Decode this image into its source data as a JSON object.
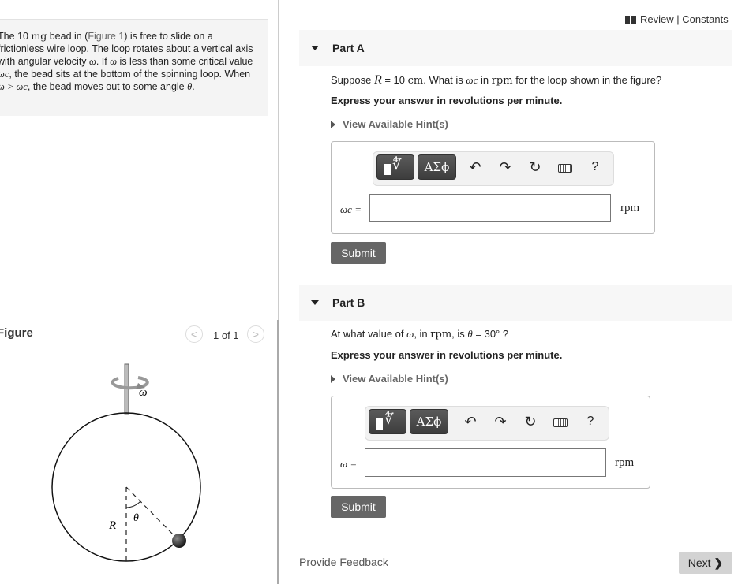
{
  "problem": {
    "intro_parts": [
      "The 10 ",
      "mg",
      " bead in (",
      "Figure 1",
      ") is free to slide on a frictionless wire loop. The loop rotates about a vertical axis with angular velocity ",
      "ω",
      ". If ",
      "ω",
      " is less than some critical value ",
      "ωc",
      ", the bead sits at the bottom of the spinning loop. When ",
      "ω > ωc",
      ", the bead moves out to some angle ",
      "θ",
      "."
    ],
    "figure_link": "Figure 1"
  },
  "figure": {
    "title": "Figure",
    "pager_label": "1 of 1",
    "prev_icon": "chevron-left-icon",
    "next_icon": "chevron-right-icon",
    "labels": {
      "omega": "ω",
      "radius": "R",
      "angle": "θ"
    }
  },
  "header": {
    "review_icon": "book-icon",
    "review_label": "Review | Constants"
  },
  "toolbar": {
    "template_icon": "template-root-icon",
    "greek_label": "ΑΣϕ",
    "undo_icon": "undo-icon",
    "redo_icon": "redo-icon",
    "reset_icon": "reset-icon",
    "keyboard_icon": "keyboard-icon",
    "help_label": "?"
  },
  "parts": [
    {
      "title": "Part A",
      "question_prefix": "Suppose ",
      "question_R": "R",
      "question_mid1": " = 10 ",
      "question_unit": "cm",
      "question_mid2": ". What is ",
      "question_var": "ωc",
      "question_mid3": " in ",
      "question_rpm": "rpm",
      "question_suffix": " for the loop shown in the figure?",
      "instruction": "Express your answer in revolutions per minute.",
      "hint_label": "View Available Hint(s)",
      "var_label": "ωc =",
      "input_value": "",
      "unit": "rpm",
      "submit_label": "Submit"
    },
    {
      "title": "Part B",
      "question_prefix": "At what value of ",
      "question_var": "ω",
      "question_mid1": ", in ",
      "question_rpm": "rpm",
      "question_mid2": ", is ",
      "question_theta": "θ",
      "question_suffix": " = 30° ?",
      "instruction": "Express your answer in revolutions per minute.",
      "hint_label": "View Available Hint(s)",
      "var_label": "ω =",
      "input_value": "",
      "unit": "rpm",
      "submit_label": "Submit"
    }
  ],
  "footer": {
    "feedback_label": "Provide Feedback",
    "next_label": "Next",
    "next_icon": "chevron-right-icon"
  }
}
